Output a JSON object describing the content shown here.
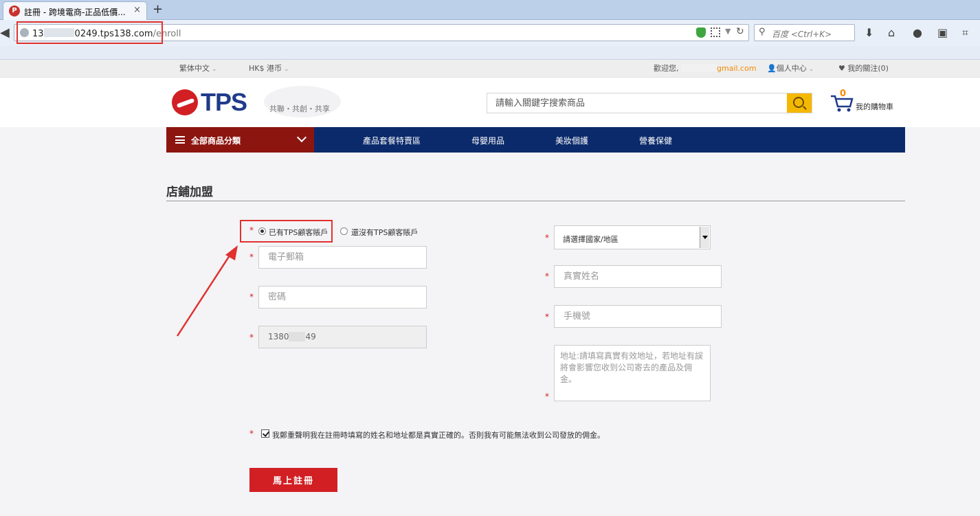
{
  "browser": {
    "tab_title": "註冊 - 跨境電商-正品低價...",
    "tab_close": "×",
    "new_tab": "+",
    "url_prefix": "13",
    "url_host_suffix": "0249.tps138.com",
    "url_path": "/enroll",
    "search_placeholder": "百度 <Ctrl+K>"
  },
  "topstrip": {
    "language": "繁体中文",
    "currency": "HK$ 港币",
    "welcome": "歡迎您,",
    "email_suffix": "gmail.com",
    "account": "個人中心",
    "follow": "我的關注(0)"
  },
  "header": {
    "logo_text": "TPS",
    "slogan": "共聯・共創・共享",
    "search_placeholder": "請輸入關鍵字搜索商品",
    "cart_count": "0",
    "cart_label": "我的購物車"
  },
  "nav": {
    "category_label": "全部商品分類",
    "links": [
      "產品套餐特賣區",
      "母嬰用品",
      "美妝個護",
      "營養保健"
    ]
  },
  "form": {
    "title": "店鋪加盟",
    "required_mark": "*",
    "radio_has_account": "已有TPS顧客賬戶",
    "radio_no_account": "還沒有TPS顧客賬戶",
    "email_placeholder": "電子郵箱",
    "password_placeholder": "密碼",
    "phone_prefill_start": "1380",
    "phone_prefill_end": "49",
    "country_select": "請選擇國家/地區",
    "realname_placeholder": "真實姓名",
    "mobile_placeholder": "手機號",
    "address_placeholder": "地址:請填寫真實有效地址，若地址有誤將會影響您收到公司寄去的產品及佣金。",
    "agreement": "我鄭重聲明我在註冊時填寫的姓名和地址都是真實正確的。否則我有可能無法收到公司發放的佣金。",
    "submit": "馬上註冊"
  },
  "colors": {
    "brand_red": "#d11f24",
    "nav_blue": "#0b2a6b",
    "category_red": "#8c1510",
    "search_yellow": "#f5b800",
    "annotation_red": "#e0312e"
  }
}
